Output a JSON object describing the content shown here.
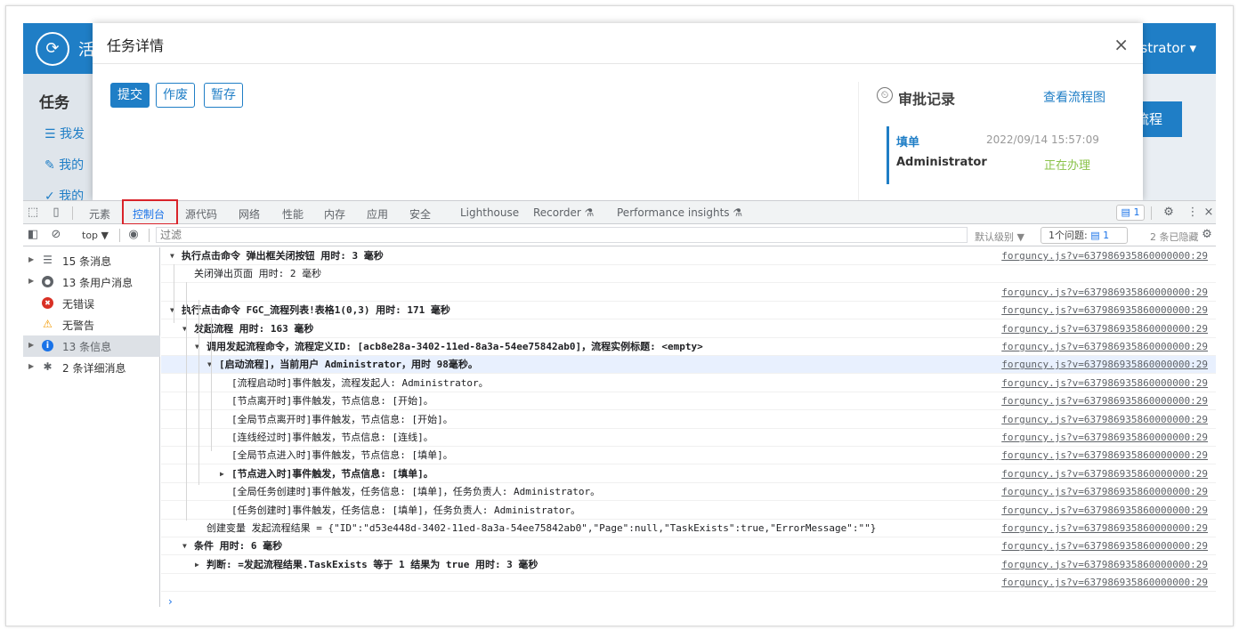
{
  "app": {
    "name_partial": "活",
    "user_partial": "strator ▾",
    "side_title": "任务",
    "side_items": [
      "☰  我发",
      "✎  我的",
      "✓  我的"
    ],
    "button_partial": "流程"
  },
  "modal": {
    "title": "任务详情",
    "close_glyph": "×",
    "buttons": {
      "submit": "提交",
      "void": "作废",
      "save_draft": "暂存"
    },
    "approval": {
      "title": "审批记录",
      "link": "查看流程图",
      "icon": "⏲",
      "node": "填单",
      "time": "2022/09/14 15:57:09",
      "user": "Administrator",
      "status": "正在办理"
    }
  },
  "devtools": {
    "tabs": [
      "元素",
      "控制台",
      "源代码",
      "网络",
      "性能",
      "内存",
      "应用",
      "安全",
      "Lighthouse",
      "Recorder ⚗",
      "Performance insights ⚗"
    ],
    "issue_badge": "1",
    "filter": {
      "context": "top ▼",
      "placeholder": "过滤",
      "levels": "默认级别 ▼",
      "issues_label": "1个问题:",
      "issues_count": "1",
      "hidden": "2 条已隐藏"
    },
    "sidebar": [
      {
        "icon": "list-icon",
        "glyph": "☰",
        "label": "15 条消息",
        "expandable": true
      },
      {
        "icon": "user-icon",
        "glyph": "●",
        "label": "13 条用户消息",
        "expandable": true
      },
      {
        "icon": "error-icon",
        "glyph": "✖",
        "label": "无错误",
        "expandable": false
      },
      {
        "icon": "warning-icon",
        "glyph": "⚠",
        "label": "无警告",
        "expandable": false
      },
      {
        "icon": "info-icon",
        "glyph": "i",
        "label": "13 条信息",
        "expandable": true
      },
      {
        "icon": "bug-icon",
        "glyph": "✱",
        "label": "2 条详细消息",
        "expandable": true
      }
    ],
    "source": "forguncy.js?v=637986935860000000:29",
    "log": [
      {
        "text": "执行点击命令 弹出框关闭按钮 用时: 3 毫秒",
        "indent": 0,
        "tri": "down",
        "bold": true
      },
      {
        "text": "关闭弹出页面 用时: 2 毫秒",
        "indent": 1,
        "tri": "",
        "bold": false
      },
      {
        "text": "",
        "indent": 0,
        "tri": "",
        "bold": false
      },
      {
        "text": "执行点击命令 FGC_流程列表!表格1(0,3) 用时: 171 毫秒",
        "indent": 0,
        "tri": "down",
        "bold": true
      },
      {
        "text": "发起流程 用时: 163 毫秒",
        "indent": 1,
        "tri": "down",
        "bold": true
      },
      {
        "text": "调用发起流程命令，流程定义ID: [acb8e28a-3402-11ed-8a3a-54ee75842ab0]，流程实例标题: <empty>",
        "indent": 2,
        "tri": "down",
        "bold": true
      },
      {
        "text": "[启动流程]，当前用户 Administrator，用时 98毫秒。",
        "indent": 3,
        "tri": "down",
        "bold": true,
        "hl": true
      },
      {
        "text": "[流程启动时]事件触发，流程发起人: Administrator。",
        "indent": 4,
        "tri": "",
        "bold": false
      },
      {
        "text": "[节点离开时]事件触发，节点信息: [开始]。",
        "indent": 4,
        "tri": "",
        "bold": false
      },
      {
        "text": "[全局节点离开时]事件触发，节点信息: [开始]。",
        "indent": 4,
        "tri": "",
        "bold": false
      },
      {
        "text": "[连线经过时]事件触发，节点信息: [连线]。",
        "indent": 4,
        "tri": "",
        "bold": false
      },
      {
        "text": "[全局节点进入时]事件触发，节点信息: [填单]。",
        "indent": 4,
        "tri": "",
        "bold": false
      },
      {
        "text": "[节点进入时]事件触发，节点信息: [填单]。",
        "indent": 4,
        "tri": "right",
        "bold": true
      },
      {
        "text": "[全局任务创建时]事件触发，任务信息: [填单]，任务负责人: Administrator。",
        "indent": 4,
        "tri": "",
        "bold": false
      },
      {
        "text": "[任务创建时]事件触发，任务信息: [填单]，任务负责人: Administrator。",
        "indent": 4,
        "tri": "",
        "bold": false
      },
      {
        "text": "创建变量 发起流程结果 = {\"ID\":\"d53e448d-3402-11ed-8a3a-54ee75842ab0\",\"Page\":null,\"TaskExists\":true,\"ErrorMessage\":\"\"}",
        "indent": 2,
        "tri": "",
        "bold": false
      },
      {
        "text": "条件 用时: 6 毫秒",
        "indent": 1,
        "tri": "down",
        "bold": true
      },
      {
        "text": "判断: =发起流程结果.TaskExists 等于 1 结果为 true 用时: 3 毫秒",
        "indent": 2,
        "tri": "right",
        "bold": true
      },
      {
        "text": "",
        "indent": 0,
        "tri": "",
        "bold": false
      }
    ],
    "prompt": "›"
  }
}
